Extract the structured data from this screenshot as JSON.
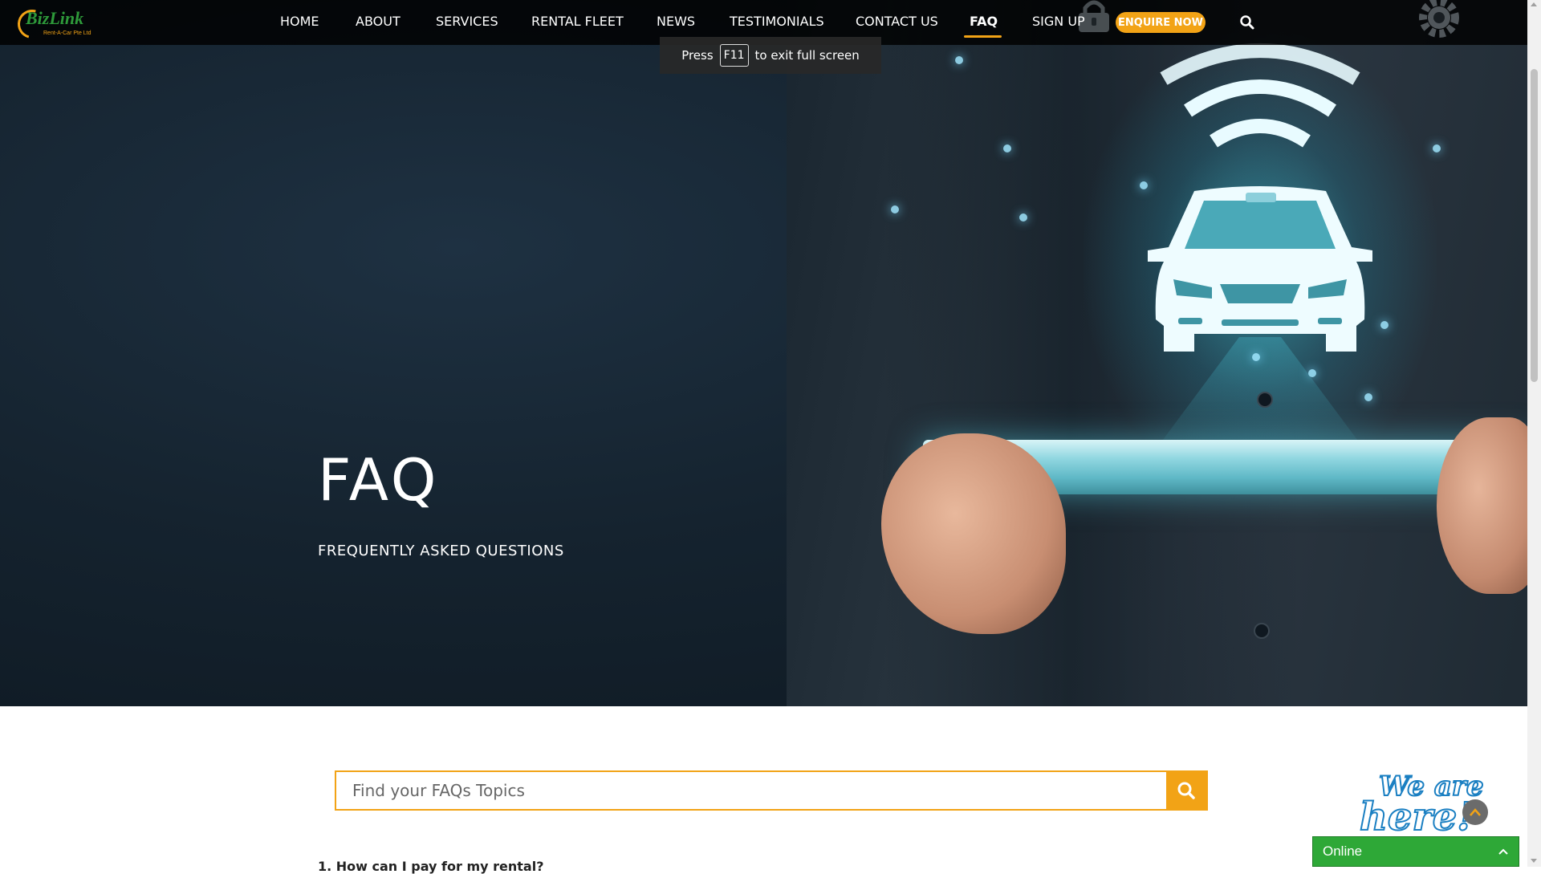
{
  "nav": {
    "logo_text": "BizLink",
    "logo_tagline": "Rent-A-Car Pte Ltd",
    "items": [
      {
        "label": "HOME"
      },
      {
        "label": "ABOUT"
      },
      {
        "label": "SERVICES"
      },
      {
        "label": "RENTAL FLEET"
      },
      {
        "label": "NEWS"
      },
      {
        "label": "TESTIMONIALS"
      },
      {
        "label": "CONTACT US"
      },
      {
        "label": "FAQ",
        "active": true
      },
      {
        "label": "SIGN UP"
      }
    ],
    "enquire_label": "ENQUIRE NOW",
    "search_icon": "search-icon"
  },
  "fullscreen_toast": {
    "press": "Press",
    "key": "F11",
    "rest": "to exit full screen"
  },
  "hero": {
    "title": "FAQ",
    "subtitle": "FREQUENTLY ASKED QUESTIONS"
  },
  "search": {
    "placeholder": "Find your FAQs Topics",
    "button_icon": "search-icon"
  },
  "faq": {
    "first_question": "1. How can I pay for my rental?"
  },
  "chat": {
    "badge_line1": "We are",
    "badge_line2": "here!",
    "status": "Online"
  },
  "colors": {
    "accent": "#f2a316",
    "chat_green": "#2ea837",
    "nav_bg": "#000000"
  }
}
